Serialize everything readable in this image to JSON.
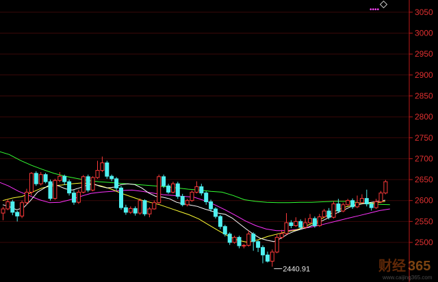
{
  "chart_data": {
    "type": "candlestick",
    "ylim": [
      2425,
      3070
    ],
    "y_ticks": [
      2500,
      2550,
      2600,
      2650,
      2700,
      2750,
      2800,
      2850,
      2900,
      2950,
      3000,
      3050
    ],
    "grid": true,
    "colors": {
      "up": "#ff3a3a",
      "down": "#4ff0f0",
      "ma5": "#ffffff",
      "ma10": "#ffff33",
      "ma20": "#ff33ff",
      "ma60": "#33ff33",
      "axis": "#c01818",
      "grid": "#3a0808"
    },
    "candles": [
      [
        2570,
        2580,
        2553,
        2585
      ],
      [
        2580,
        2597,
        2577,
        2603
      ],
      [
        2597,
        2572,
        2565,
        2602
      ],
      [
        2572,
        2563,
        2550,
        2576
      ],
      [
        2563,
        2595,
        2558,
        2600
      ],
      [
        2595,
        2620,
        2590,
        2628
      ],
      [
        2620,
        2665,
        2612,
        2668
      ],
      [
        2665,
        2640,
        2635,
        2670
      ],
      [
        2640,
        2662,
        2636,
        2668
      ],
      [
        2662,
        2645,
        2641,
        2666
      ],
      [
        2645,
        2605,
        2600,
        2650
      ],
      [
        2605,
        2648,
        2602,
        2652
      ],
      [
        2648,
        2658,
        2644,
        2668
      ],
      [
        2658,
        2645,
        2637,
        2662
      ],
      [
        2645,
        2618,
        2612,
        2650
      ],
      [
        2618,
        2596,
        2590,
        2625
      ],
      [
        2596,
        2620,
        2592,
        2626
      ],
      [
        2620,
        2657,
        2617,
        2661
      ],
      [
        2657,
        2625,
        2620,
        2662
      ],
      [
        2625,
        2655,
        2622,
        2658
      ],
      [
        2655,
        2672,
        2652,
        2695
      ],
      [
        2672,
        2690,
        2668,
        2705
      ],
      [
        2690,
        2658,
        2652,
        2695
      ],
      [
        2658,
        2652,
        2646,
        2662
      ],
      [
        2652,
        2630,
        2624,
        2656
      ],
      [
        2630,
        2583,
        2578,
        2635
      ],
      [
        2583,
        2572,
        2566,
        2590
      ],
      [
        2572,
        2581,
        2568,
        2586
      ],
      [
        2581,
        2570,
        2564,
        2586
      ],
      [
        2570,
        2600,
        2566,
        2605
      ],
      [
        2600,
        2568,
        2563,
        2603
      ],
      [
        2568,
        2580,
        2560,
        2584
      ],
      [
        2580,
        2595,
        2578,
        2600
      ],
      [
        2595,
        2657,
        2592,
        2662
      ],
      [
        2657,
        2635,
        2630,
        2662
      ],
      [
        2635,
        2620,
        2616,
        2640
      ],
      [
        2620,
        2640,
        2617,
        2645
      ],
      [
        2640,
        2610,
        2604,
        2645
      ],
      [
        2610,
        2590,
        2586,
        2616
      ],
      [
        2590,
        2600,
        2586,
        2604
      ],
      [
        2600,
        2620,
        2597,
        2624
      ],
      [
        2620,
        2633,
        2617,
        2646
      ],
      [
        2633,
        2618,
        2612,
        2640
      ],
      [
        2618,
        2597,
        2590,
        2622
      ],
      [
        2597,
        2580,
        2573,
        2602
      ],
      [
        2580,
        2562,
        2557,
        2584
      ],
      [
        2562,
        2538,
        2532,
        2566
      ],
      [
        2538,
        2520,
        2514,
        2542
      ],
      [
        2520,
        2500,
        2494,
        2524
      ],
      [
        2500,
        2512,
        2497,
        2516
      ],
      [
        2512,
        2492,
        2486,
        2516
      ],
      [
        2492,
        2493,
        2486,
        2496
      ],
      [
        2493,
        2520,
        2490,
        2528
      ],
      [
        2520,
        2502,
        2480,
        2524
      ],
      [
        2502,
        2488,
        2477,
        2505
      ],
      [
        2488,
        2470,
        2450,
        2493
      ],
      [
        2470,
        2455,
        2452,
        2478
      ],
      [
        2455,
        2477,
        2442,
        2483
      ],
      [
        2477,
        2512,
        2474,
        2520
      ],
      [
        2512,
        2521,
        2508,
        2530
      ],
      [
        2521,
        2547,
        2518,
        2570
      ],
      [
        2547,
        2540,
        2534,
        2553
      ],
      [
        2540,
        2550,
        2537,
        2560
      ],
      [
        2550,
        2536,
        2530,
        2555
      ],
      [
        2536,
        2547,
        2532,
        2558
      ],
      [
        2547,
        2557,
        2544,
        2568
      ],
      [
        2557,
        2540,
        2535,
        2562
      ],
      [
        2540,
        2561,
        2537,
        2568
      ],
      [
        2561,
        2575,
        2558,
        2580
      ],
      [
        2575,
        2560,
        2555,
        2582
      ],
      [
        2560,
        2592,
        2557,
        2598
      ],
      [
        2592,
        2575,
        2570,
        2604
      ],
      [
        2575,
        2590,
        2572,
        2595
      ],
      [
        2590,
        2600,
        2587,
        2604
      ],
      [
        2600,
        2585,
        2580,
        2605
      ],
      [
        2585,
        2595,
        2582,
        2612
      ],
      [
        2595,
        2605,
        2592,
        2615
      ],
      [
        2605,
        2592,
        2586,
        2626
      ],
      [
        2592,
        2583,
        2576,
        2596
      ],
      [
        2583,
        2597,
        2580,
        2604
      ],
      [
        2597,
        2618,
        2594,
        2623
      ],
      [
        2618,
        2645,
        2615,
        2649
      ]
    ],
    "ma5": [
      2590,
      2585,
      2578,
      2583,
      2600,
      2620,
      2630,
      2640,
      2635,
      2628,
      2625,
      2630,
      2636,
      2640,
      2634,
      2630,
      2632,
      2638,
      2640,
      2638,
      2630,
      2618,
      2610,
      2608,
      2604,
      2596,
      2592,
      2589,
      2586,
      2580,
      2575,
      2570,
      2567,
      2558,
      2545,
      2532,
      2520,
      2510,
      2505,
      2502,
      2510,
      2520,
      2527,
      2532,
      2537,
      2545,
      2552,
      2560,
      2570,
      2577,
      2585,
      2590,
      2593,
      2596,
      2598,
      2601
    ],
    "ma5_x": [
      0,
      2,
      4,
      6,
      8,
      10,
      12,
      14,
      16,
      18,
      20,
      22,
      24,
      26,
      28,
      30,
      32,
      34,
      36,
      38,
      40,
      42,
      44,
      46,
      48,
      50,
      52,
      54,
      56,
      58,
      60,
      62,
      64,
      66,
      68,
      70,
      72,
      74,
      76,
      78,
      80,
      81
    ],
    "ma10": [
      2600,
      2606,
      2610,
      2620,
      2630,
      2635,
      2637,
      2640,
      2642,
      2640,
      2635,
      2628,
      2618,
      2610,
      2602,
      2596,
      2590,
      2582,
      2574,
      2566,
      2556,
      2542,
      2528,
      2515,
      2505,
      2500,
      2506,
      2514,
      2520,
      2526,
      2530,
      2540,
      2550,
      2563,
      2576,
      2585,
      2590,
      2594,
      2594,
      2598
    ],
    "ma20": [
      2645,
      2635,
      2622,
      2612,
      2602,
      2595,
      2596,
      2602,
      2610,
      2617,
      2620,
      2622,
      2624,
      2625,
      2622,
      2618,
      2614,
      2612,
      2610,
      2608,
      2600,
      2590,
      2578,
      2565,
      2551,
      2540,
      2532,
      2528,
      2528,
      2531,
      2535,
      2540,
      2546,
      2552,
      2558,
      2564,
      2570,
      2576,
      2580
    ],
    "ma60": [
      2718,
      2710,
      2696,
      2684,
      2674,
      2665,
      2658,
      2653,
      2648,
      2645,
      2643,
      2641,
      2639,
      2637,
      2635,
      2633,
      2630,
      2627,
      2625,
      2622,
      2620,
      2612,
      2602,
      2598,
      2596,
      2595,
      2595,
      2596,
      2596,
      2597,
      2598,
      2598,
      2596,
      2592,
      2591,
      2590
    ]
  },
  "annotations": {
    "low_label": "2440.91"
  },
  "watermark": {
    "part1": "财经",
    "part2": "365",
    "url": "www.caijing365.com"
  },
  "toolbar": {
    "icon": "diamond-icon",
    "dots": "••••"
  }
}
